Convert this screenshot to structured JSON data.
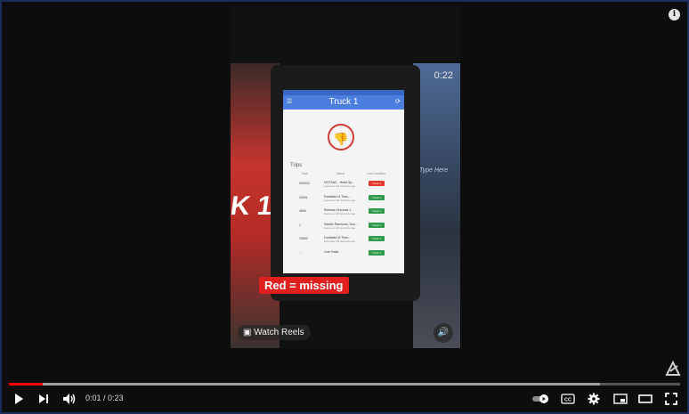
{
  "video": {
    "time_overlay": "0:22",
    "caption": "Red = missing",
    "reels_label": "Watch Reels",
    "background_text_left": "K 1",
    "background_text_right": "Type Here"
  },
  "app": {
    "title": "Truck 1",
    "trips_label": "Trips",
    "columns": [
      "Trip#",
      "Name",
      "Last Location"
    ],
    "rows": [
      {
        "id": "909303",
        "name": "HOTSAC - Head Sp...",
        "sub": "Last seen 16 seconds ago",
        "status": "Truck 1",
        "status_color": "#e3372d"
      },
      {
        "id": "20591",
        "name": "Fontlabs Lft Then...",
        "sub": "Last seen 20 seconds ago",
        "status": "Truck 1",
        "status_color": "#2e9b4a"
      },
      {
        "id": "4896",
        "name": "Release Grounds 1",
        "sub": "Last seen 20 seconds ago",
        "status": "Truck 1",
        "status_color": "#2e9b4a"
      },
      {
        "id": "1",
        "name": "Saddle Ramsons, Dun...",
        "sub": "Last seen 20 seconds ago",
        "status": "Truck 1",
        "status_color": "#2e9b4a"
      },
      {
        "id": "20893",
        "name": "Fontlabs Lft Then...",
        "sub": "Last seen 20 seconds ago",
        "status": "Truck 1",
        "status_color": "#2e9b4a"
      },
      {
        "id": "...",
        "name": "Coin Ratio",
        "sub": "",
        "status": "Truck 1",
        "status_color": "#2e9b4a"
      }
    ]
  },
  "player": {
    "current_time": "0:01",
    "separator": " / ",
    "duration": "0:23",
    "progress_played": 0.05,
    "progress_loaded": 0.88,
    "accent_color": "#ff0000"
  },
  "icons": {
    "play": "play-icon",
    "next": "skip-next-icon",
    "volume": "volume-icon",
    "autoplay": "autoplay-toggle-icon",
    "captions": "captions-icon",
    "settings": "gear-icon",
    "miniplayer": "miniplayer-icon",
    "theater": "theater-mode-icon",
    "fullscreen": "fullscreen-icon",
    "info": "info-icon"
  }
}
